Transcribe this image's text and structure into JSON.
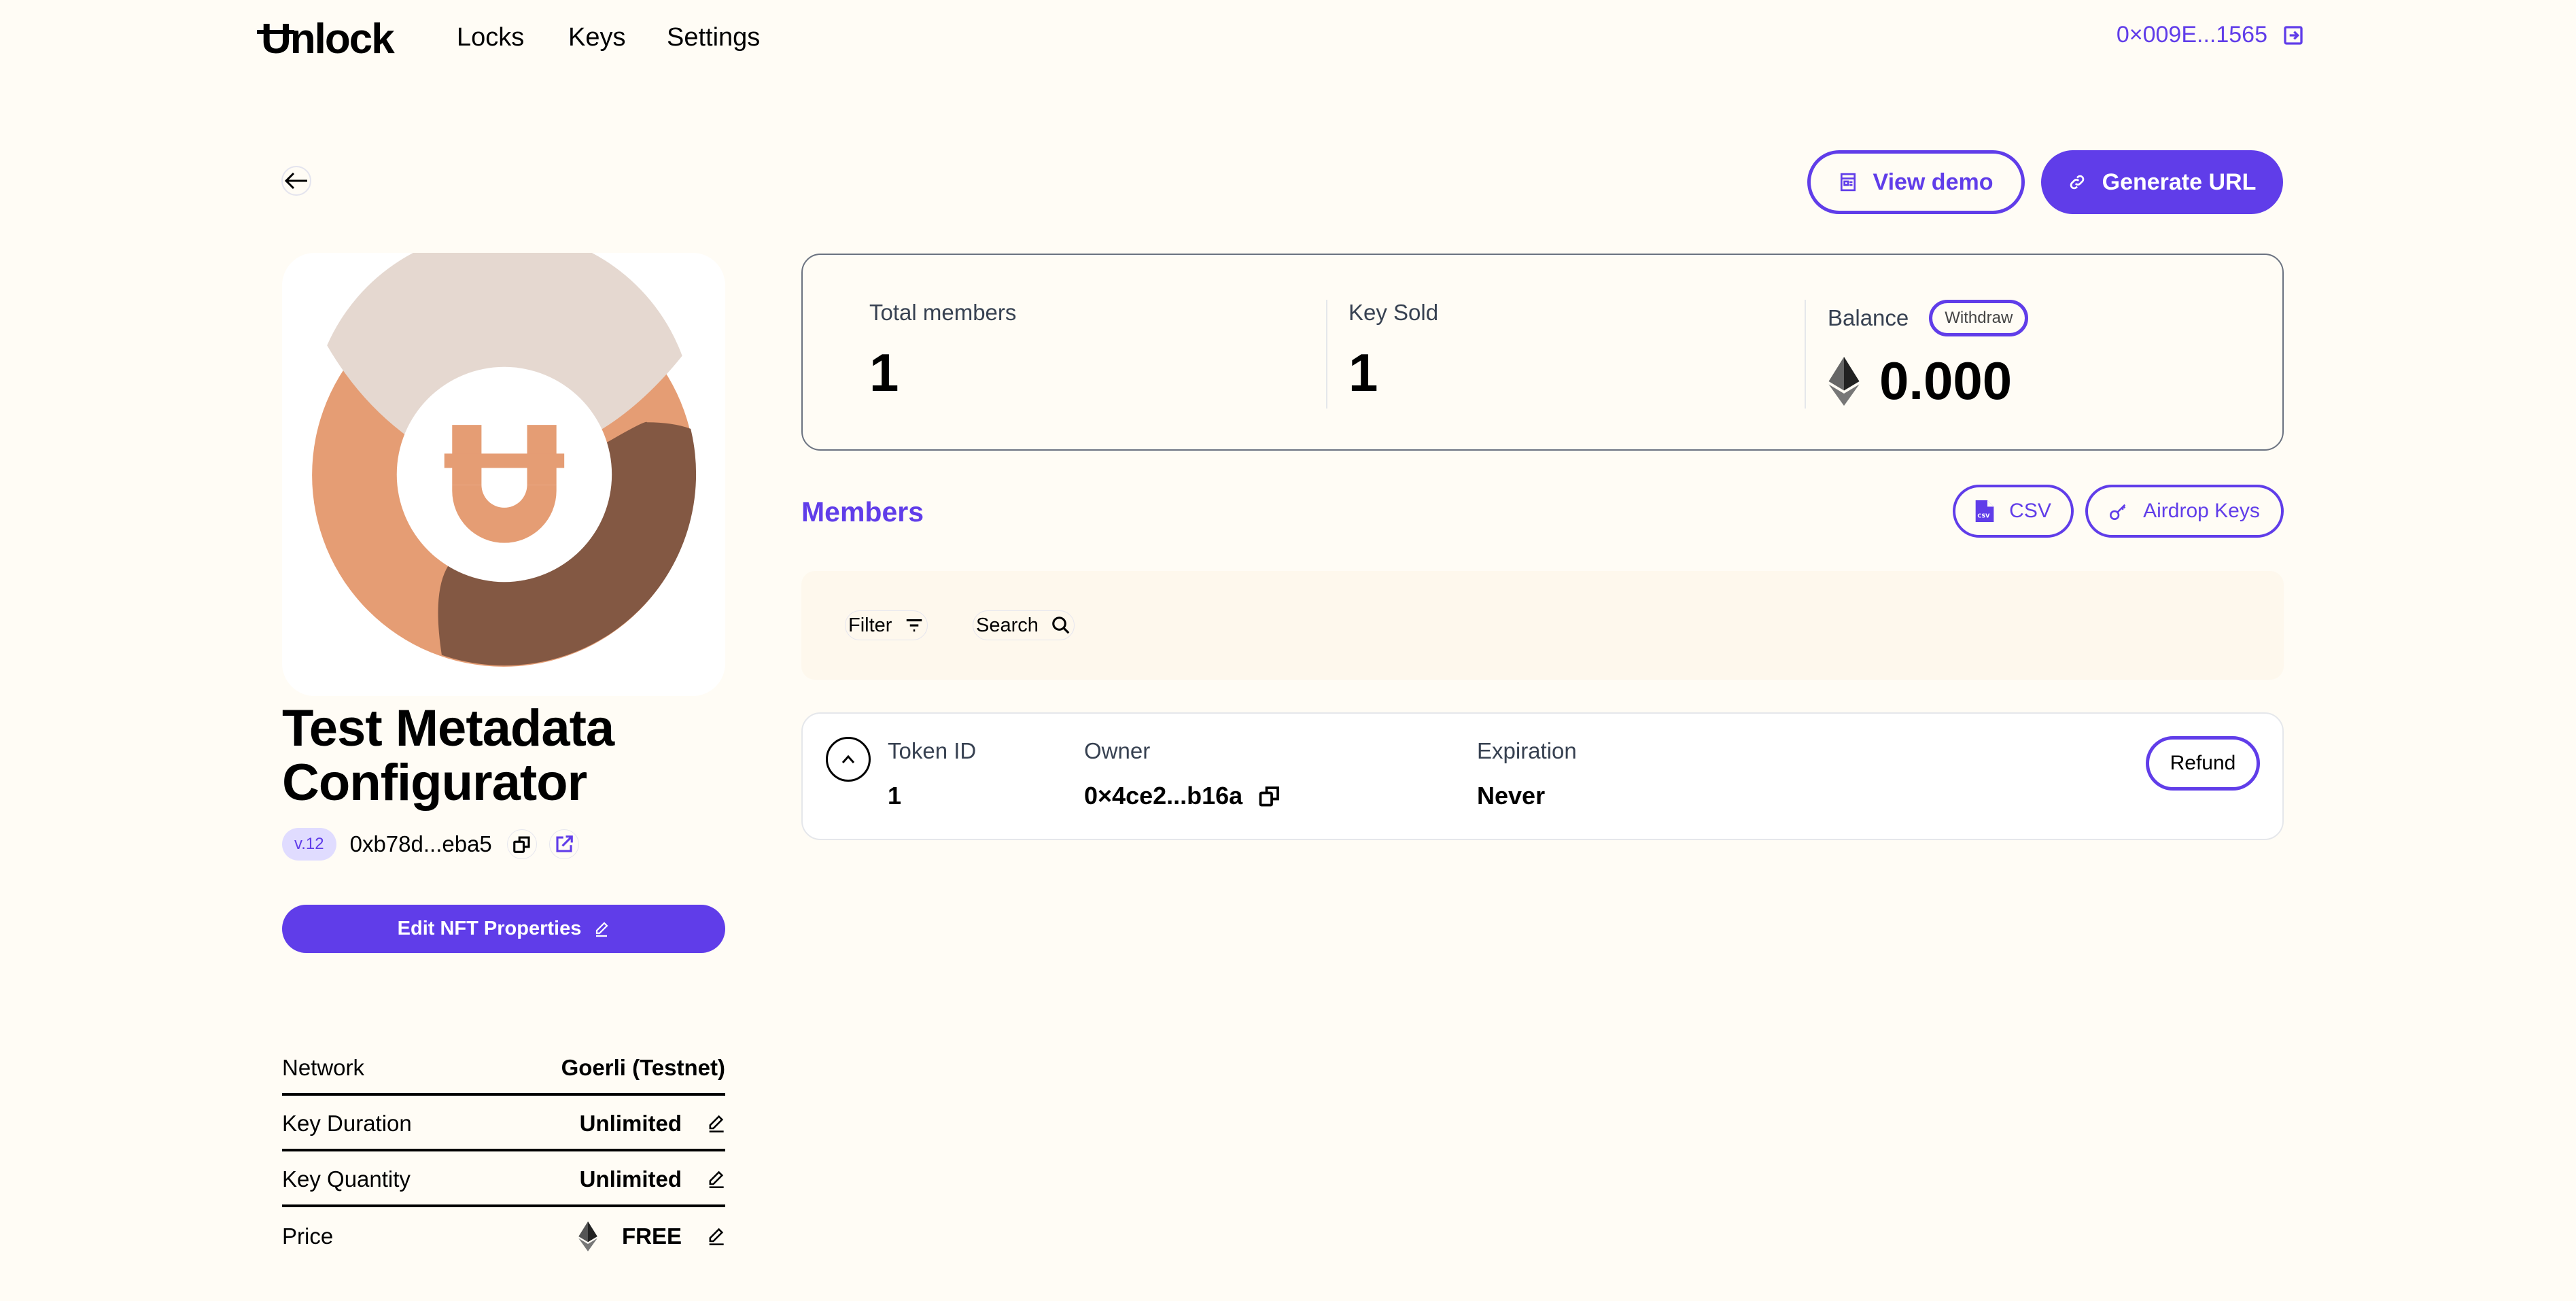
{
  "header": {
    "logo": "Unlock",
    "nav": [
      {
        "label": "Locks"
      },
      {
        "label": "Keys"
      },
      {
        "label": "Settings"
      }
    ],
    "account_address": "0×009E...1565",
    "account_icon": "sign-out-icon"
  },
  "actions": {
    "back_icon": "arrow-left-icon",
    "view_demo": "View demo",
    "generate_url": "Generate URL"
  },
  "lock": {
    "title": "Test Metadata Configurator",
    "version": "v.12",
    "address": "0xb78d...eba5",
    "edit_button": "Edit NFT Properties",
    "image_colors": [
      "#e5d8d0",
      "#e59d74",
      "#835843"
    ],
    "properties": [
      {
        "label": "Network",
        "value": "Goerli (Testnet)",
        "editable": false
      },
      {
        "label": "Key Duration",
        "value": "Unlimited",
        "editable": true
      },
      {
        "label": "Key Quantity",
        "value": "Unlimited",
        "editable": true
      },
      {
        "label": "Price",
        "value": "FREE",
        "editable": true,
        "currency_icon": "ethereum-icon"
      }
    ]
  },
  "stats": {
    "total_members_label": "Total members",
    "total_members": "1",
    "keys_sold_label": "Key Sold",
    "keys_sold": "1",
    "balance_label": "Balance",
    "withdraw_label": "Withdraw",
    "balance": "0.000"
  },
  "members": {
    "title": "Members",
    "csv_label": "CSV",
    "airdrop_label": "Airdrop Keys",
    "filter_label": "Filter",
    "search_label": "Search",
    "columns": {
      "token": "Token ID",
      "owner": "Owner",
      "expiration": "Expiration"
    },
    "rows": [
      {
        "token_id": "1",
        "owner": "0×4ce2...b16a",
        "expiration": "Never",
        "action": "Refund"
      }
    ]
  },
  "colors": {
    "accent": "#603de9",
    "background": "#fffcf5"
  }
}
